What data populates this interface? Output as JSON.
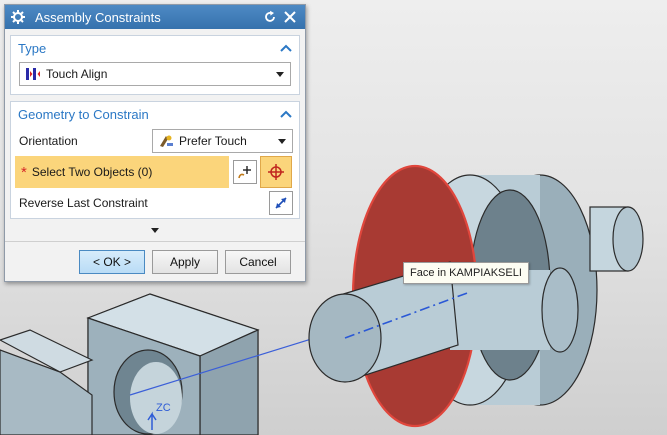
{
  "dialog": {
    "title": "Assembly Constraints",
    "title_icon": "gear-icon",
    "reset_icon": "reset-icon",
    "close_icon": "close-icon"
  },
  "type_section": {
    "header": "Type",
    "value": "Touch Align",
    "value_icon": "touch-align-icon"
  },
  "geometry_section": {
    "header": "Geometry to Constrain",
    "orientation_label": "Orientation",
    "orientation_value": "Prefer Touch",
    "orientation_icon": "prefer-touch-icon",
    "select_label": "Select Two Objects (0)",
    "required_marker": "*",
    "reverse_label": "Reverse Last Constraint"
  },
  "buttons": {
    "ok": "< OK >",
    "apply": "Apply",
    "cancel": "Cancel"
  },
  "viewport": {
    "tooltip": "Face in KAMPIAKSELI",
    "axis_label": "ZC",
    "highlight_color": "#a83a33",
    "part_color": "#b9ccd6"
  }
}
